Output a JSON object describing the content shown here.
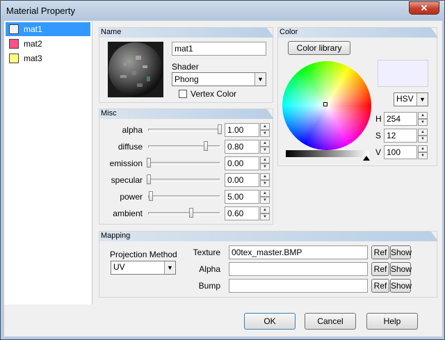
{
  "window": {
    "title": "Material Property",
    "close_label": "✕"
  },
  "materials": [
    {
      "label": "mat1",
      "color": "#f0f0ff",
      "selected": true
    },
    {
      "label": "mat2",
      "color": "#ff4f87",
      "selected": false
    },
    {
      "label": "mat3",
      "color": "#ffff80",
      "selected": false
    }
  ],
  "name_panel": {
    "title": "Name",
    "name_value": "mat1",
    "shader_label": "Shader",
    "shader_value": "Phong",
    "vertex_color_label": "Vertex Color",
    "vertex_color_checked": false
  },
  "misc_panel": {
    "title": "Misc",
    "params": [
      {
        "label": "alpha",
        "value": "1.00",
        "level": 1.0
      },
      {
        "label": "diffuse",
        "value": "0.80",
        "level": 0.8
      },
      {
        "label": "emission",
        "value": "0.00",
        "level": 0.0
      },
      {
        "label": "specular",
        "value": "0.00",
        "level": 0.0
      },
      {
        "label": "power",
        "value": "5.00",
        "level": 0.03
      },
      {
        "label": "ambient",
        "value": "0.60",
        "level": 0.6
      }
    ]
  },
  "color_panel": {
    "title": "Color",
    "library_button": "Color library",
    "mode": "HSV",
    "preview_color": "#efefff",
    "fields": [
      {
        "label": "H",
        "value": "254"
      },
      {
        "label": "S",
        "value": "12"
      },
      {
        "label": "V",
        "value": "100"
      }
    ]
  },
  "mapping_panel": {
    "title": "Mapping",
    "projection_label": "Projection Method",
    "projection_value": "UV",
    "rows": [
      {
        "label": "Texture",
        "value": "00tex_master.BMP",
        "ref": "Ref",
        "show": "Show"
      },
      {
        "label": "Alpha",
        "value": "",
        "ref": "Ref",
        "show": "Show"
      },
      {
        "label": "Bump",
        "value": "",
        "ref": "Ref",
        "show": "Show"
      }
    ]
  },
  "footer": {
    "ok_label": "OK",
    "cancel_label": "Cancel",
    "help_label": "Help"
  }
}
